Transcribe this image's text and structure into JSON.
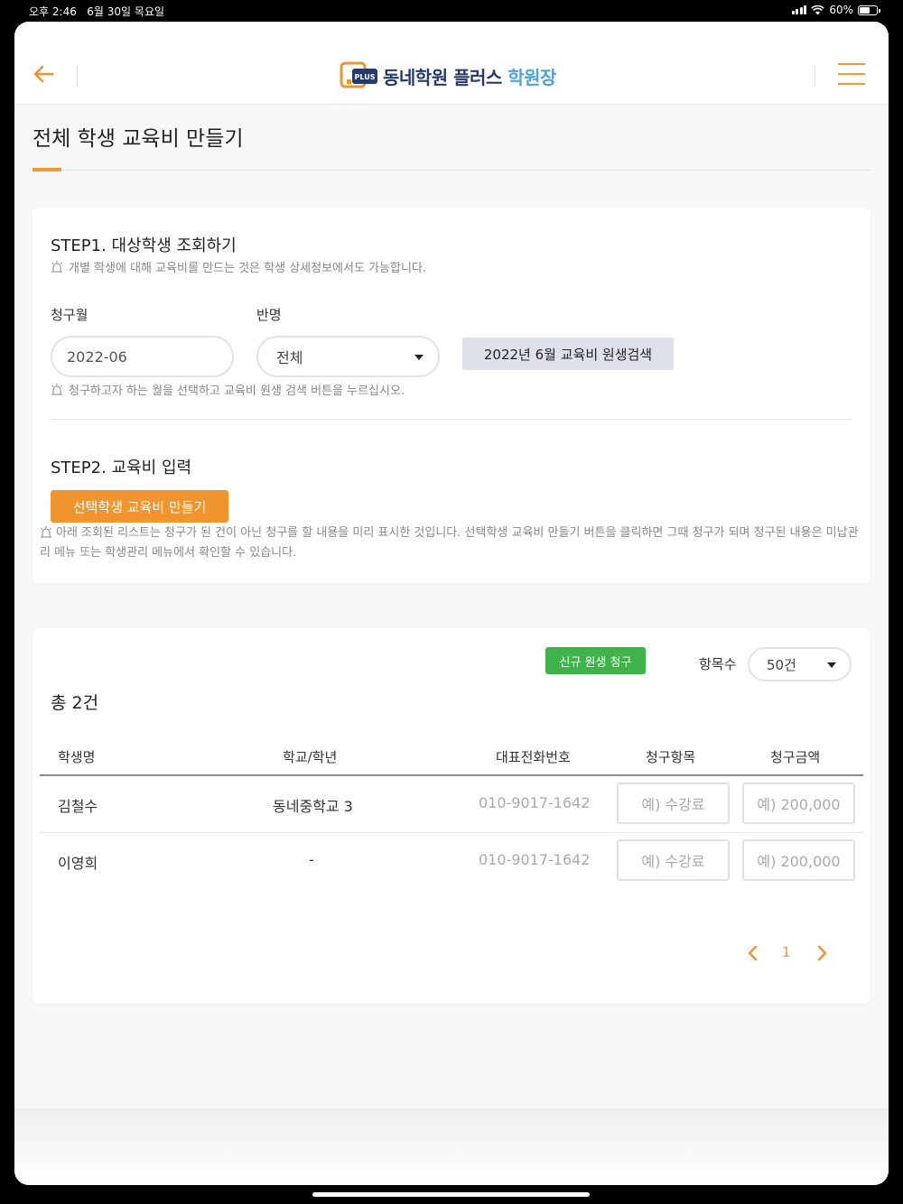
{
  "status": {
    "time": "오후 2:46",
    "date": "6월 30일 목요일",
    "battery": "60%",
    "battery_level": 0.6
  },
  "header": {
    "logo_badge": "PLUS",
    "logo_main": "동네학원 플러스",
    "logo_accent": "학원장"
  },
  "page": {
    "title": "전체 학생 교육비 만들기"
  },
  "step1": {
    "title": "STEP1. 대상학생 조회하기",
    "hint": "개별 학생에 대해 교육비를 만드는 것은 학생 상세정보에서도 가능합니다.",
    "month_label": "청구월",
    "month_value": "2022-06",
    "class_label": "반명",
    "class_value": "전체",
    "search_button": "2022년 6월 교육비 원생검색",
    "search_hint": "청구하고자 하는 월을 선택하고 교육비 원생 검색 버튼을 누르십시오."
  },
  "step2": {
    "title": "STEP2. 교육비 입력",
    "create_button": "선택학생 교육비 만들기",
    "hint": "아래 조회된 리스트는 청구가 된 건이 아닌 청구를 할 내용을 미리 표시한 것입니다. 선택학생 교육비 만들기 버튼을 클릭하면 그때 청구가 되며 청구된 내용은 미납관리 메뉴 또는 학생관리 메뉴에서 확인할 수 있습니다."
  },
  "list": {
    "new_bill_button": "신규 원생 청구",
    "count_label": "항목수",
    "count_value": "50건",
    "total": "총 2건",
    "columns": [
      "학생명",
      "학교/학년",
      "대표전화번호",
      "청구항목",
      "청구금액"
    ],
    "rows": [
      {
        "name": "김철수",
        "school": "동네중학교 3",
        "phone": "010-9017-1642",
        "item_placeholder": "예) 수강료",
        "amount_placeholder": "예) 200,000"
      },
      {
        "name": "이영희",
        "school": "-",
        "phone": "010-9017-1642",
        "item_placeholder": "예) 수강료",
        "amount_placeholder": "예) 200,000"
      }
    ],
    "pagination": {
      "current": "1"
    }
  },
  "colors": {
    "accent": "#f0952e",
    "green": "#3fb24a",
    "navy": "#243a6b",
    "blue": "#4aa3e8"
  }
}
